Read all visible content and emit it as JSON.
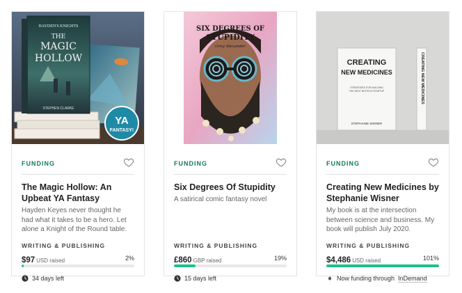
{
  "cards": [
    {
      "status": "FUNDING",
      "title": "The Magic Hollow: An Upbeat YA Fantasy",
      "description": "Hayden Keyes never thought he had what it takes to be a hero. Let alone a Knight of the Round table.",
      "category": "WRITING & PUBLISHING",
      "amount": "$97",
      "currency_note": "USD raised",
      "percent": "2%",
      "progress": 0.02,
      "footer": "34 days left",
      "footer_icon": "clock-icon",
      "cover": {
        "series": "HAYDEN'S KNIGHTS",
        "title_line1": "THE",
        "title_line2": "MAGIC",
        "title_line3": "HOLLOW",
        "author": "STEPHEN CLARKE",
        "badge_line1": "YA",
        "badge_line2": "FANTASY!"
      }
    },
    {
      "status": "FUNDING",
      "title": "Six Degrees Of Stupidity",
      "description": "A satirical comic fantasy novel",
      "category": "WRITING & PUBLISHING",
      "amount": "£860",
      "currency_note": "GBP raised",
      "percent": "19%",
      "progress": 0.19,
      "footer": "15 days left",
      "footer_icon": "clock-icon",
      "cover": {
        "title_line1": "SIX DEGREES OF",
        "title_line2": "STUPIDITY",
        "author": "Greg Alexander"
      }
    },
    {
      "status": "FUNDING",
      "title": "Creating New Medicines by Stephanie Wisner",
      "description": "My book is at the intersection between science and business. My book will publish July 2020.",
      "category": "WRITING & PUBLISHING",
      "amount": "$4,486",
      "currency_note": "USD raised",
      "percent": "101%",
      "progress": 1.0,
      "footer": "Now funding through",
      "footer_link": "InDemand",
      "footer_icon": "flame-icon",
      "cover": {
        "title_line1": "CREATING",
        "title_line2": "NEW MEDICINES",
        "subtitle_line1": "STRATEGIES FOR BUILDING",
        "subtitle_line2": "THE NEXT BIOTECH STARTUP",
        "author": "STEPHANIE WISNER",
        "spine": "CREATING NEW MEDICINES"
      }
    }
  ],
  "colors": {
    "accent": "#0f7a5c",
    "progress": "#1dbf8e",
    "track": "#e8e8e8"
  }
}
